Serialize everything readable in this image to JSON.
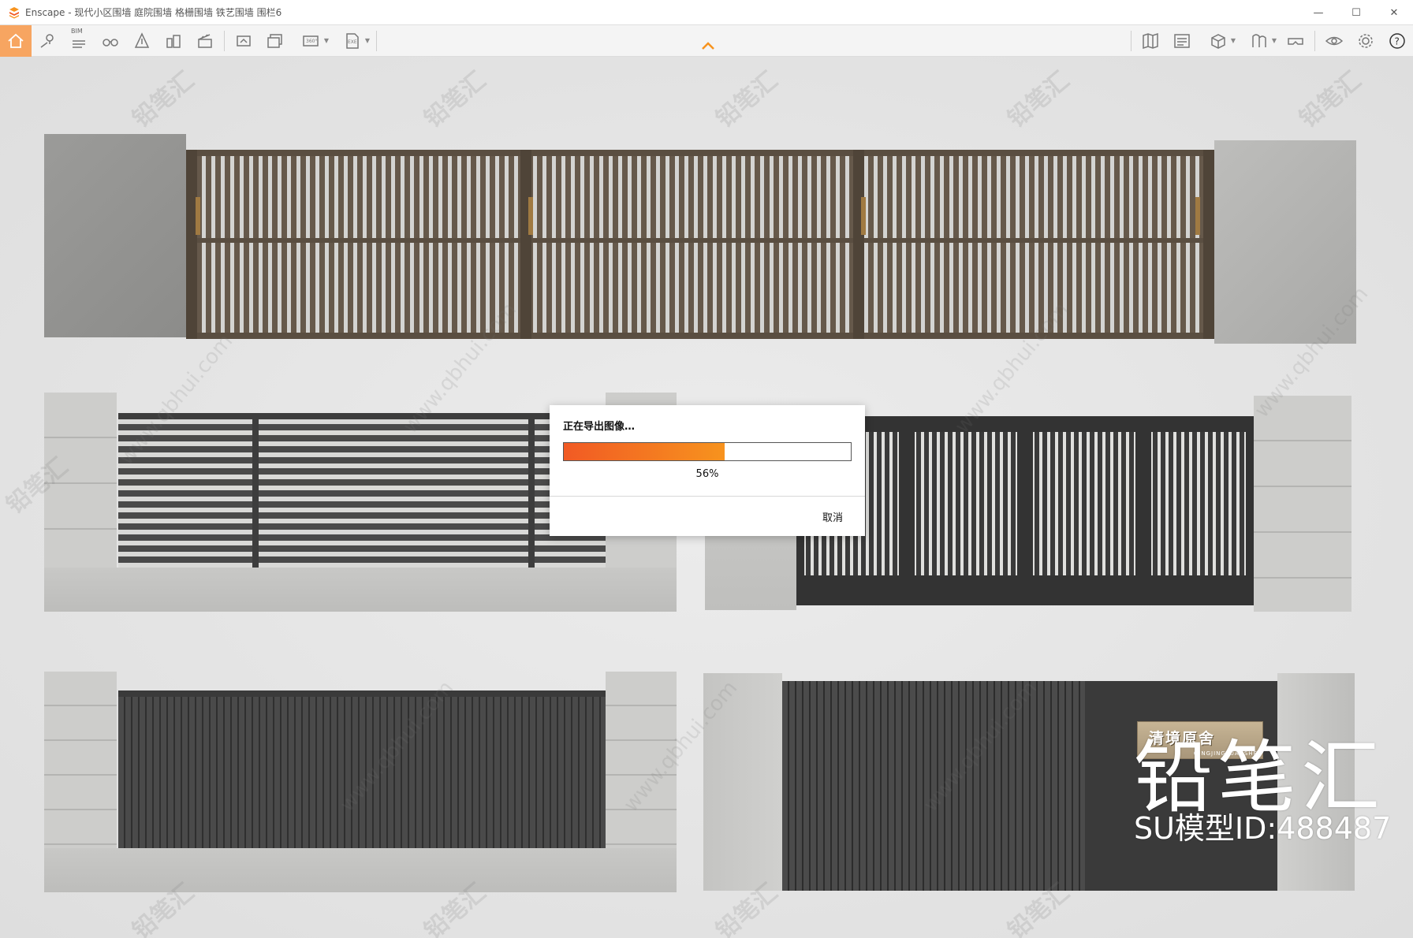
{
  "window": {
    "title": "Enscape - 现代小区围墙 庭院围墙 格栅围墙 铁艺围墙 围栏6",
    "controls": {
      "minimize": "—",
      "maximize": "☐",
      "close": "✕"
    }
  },
  "toolbar": {
    "bim_label": "BIM",
    "left_icons": [
      "home-icon",
      "location-pin-icon",
      "bim-list-icon",
      "binoculars-icon",
      "compass-icon",
      "buildings-icon",
      "clapper-icon",
      "screenshot-icon",
      "batch-render-icon",
      "panorama-360-icon",
      "exe-export-icon"
    ],
    "right_icons": [
      "map-icon",
      "asset-library-icon",
      "cube-view-icon",
      "material-icon",
      "vr-headset-icon",
      "visibility-icon",
      "settings-gear-icon",
      "help-icon"
    ],
    "accent": "#f7a561"
  },
  "viewport": {
    "brand_text": "铅笔汇",
    "model_id": "SU模型ID:488487",
    "nameplate_title": "清境原舍",
    "nameplate_sub": "QINGJINGYUANSHE",
    "watermark_cn": "铅笔汇",
    "watermark_url": "www.qbhui.com"
  },
  "dialog": {
    "title": "正在导出图像…",
    "progress_percent": 56,
    "progress_label": "56%",
    "cancel_label": "取消",
    "progress_colors": [
      "#f15a24",
      "#f7931e"
    ]
  }
}
